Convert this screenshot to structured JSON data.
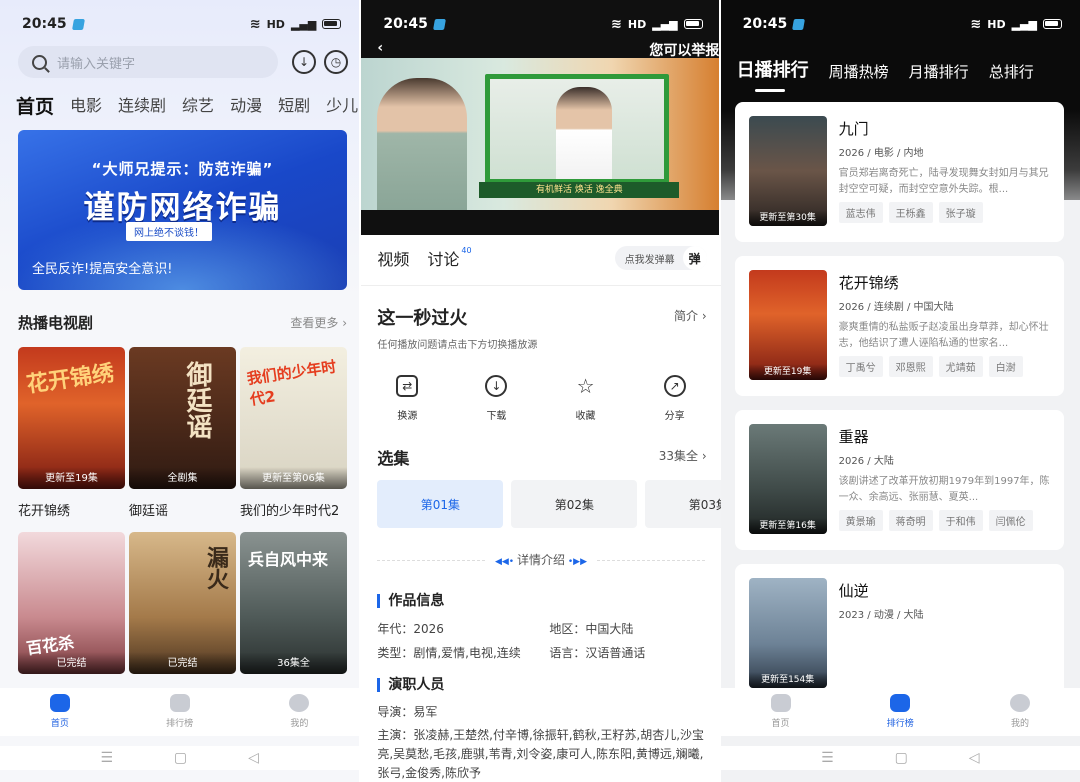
{
  "time": "20:45",
  "status_icons": "HD",
  "home": {
    "search_placeholder": "请输入关键字",
    "categories": [
      "首页",
      "电影",
      "连续剧",
      "综艺",
      "动漫",
      "短剧",
      "少儿"
    ],
    "banner": {
      "line1": "“大师兄提示：防范诈骗”",
      "line2": "谨防网络诈骗",
      "badge": "网上绝不谈钱！",
      "line3": "全民反诈!提高安全意识!"
    },
    "section_title": "热播电视剧",
    "section_more": "查看更多 ›",
    "cards": [
      {
        "title": "花开锦绣",
        "label": "更新至19集",
        "art": "花开锦绣"
      },
      {
        "title": "御廷谣",
        "label": "全剧集",
        "art": "御廷谣"
      },
      {
        "title": "我们的少年时代2",
        "label": "更新至第06集",
        "art": "我们的少年时代2"
      },
      {
        "title": "",
        "label": "已完结",
        "art": "百花杀"
      },
      {
        "title": "",
        "label": "已完结",
        "art": "漏火"
      },
      {
        "title": "",
        "label": "36集全",
        "art": "兵自风中来"
      }
    ],
    "nav": [
      "首页",
      "排行榜",
      "我的"
    ]
  },
  "detail": {
    "report": "您可以举报",
    "ad_text": "有机鲜活 焕活 逸全典",
    "tabs": [
      "视频",
      "讨论"
    ],
    "discuss_count": "40",
    "danmaku_hint": "点我发弹幕",
    "danmaku_btn": "弹",
    "title": "这一秒过火",
    "intro": "简介 ›",
    "hint": "任何播放问题请点击下方切换播放源",
    "actions": [
      "换源",
      "下载",
      "收藏",
      "分享"
    ],
    "select_label": "选集",
    "episodes_total": "33集全 ›",
    "episodes": [
      "第01集",
      "第02集",
      "第03集"
    ],
    "detail_intro": "详情介绍",
    "info_title": "作品信息",
    "year": "年代：2026",
    "region": "地区：中国大陆",
    "type": "类型：剧情,爱情,电视,连续",
    "language": "语言：汉语普通话",
    "cast_title": "演职人员",
    "director": "导演：易军",
    "cast": "主演：张凌赫,王楚然,付辛博,徐振轩,鹤秋,王籽苏,胡杏儿,沙宝亮,吴莫愁,毛孩,鹿骐,苇青,刘令姿,康可人,陈东阳,黄博远,斓曦,张弓,金俊秀,陈欣予"
  },
  "ranking": {
    "tabs": [
      "日播排行",
      "周播热榜",
      "月播排行",
      "总排行"
    ],
    "items": [
      {
        "name": "九门",
        "meta": "2026 / 电影 / 内地",
        "desc": "官员郑岩离奇死亡，陆寻发现舞女封如月与其兄封空空可疑，而封空空意外失踪。根...",
        "badge": "更新至第30集",
        "tags": [
          "蓝志伟",
          "王栎鑫",
          "张子璇"
        ]
      },
      {
        "name": "花开锦绣",
        "meta": "2026 / 连续剧 / 中国大陆",
        "desc": "豪爽重情的私盐贩子赵凌虽出身草莽，却心怀壮志，他结识了遭人诬陷私通的世家名...",
        "badge": "更新至19集",
        "tags": [
          "丁禹兮",
          "邓恩熙",
          "尤靖茹",
          "白澍"
        ]
      },
      {
        "name": "重器",
        "meta": "2026 / 大陆",
        "desc": "该剧讲述了改革开放初期1979年到1997年，陈一众、余高远、张丽慧、夏英...",
        "badge": "更新至第16集",
        "tags": [
          "黄景瑜",
          "蒋奇明",
          "于和伟",
          "闫佩伦"
        ]
      },
      {
        "name": "仙逆",
        "meta": "2023 / 动漫 / 大陆",
        "desc": "",
        "badge": "更新至154集",
        "tags": []
      }
    ],
    "nav": [
      "首页",
      "排行榜",
      "我的"
    ]
  },
  "colors": {
    "accent": "#1c66e8"
  }
}
